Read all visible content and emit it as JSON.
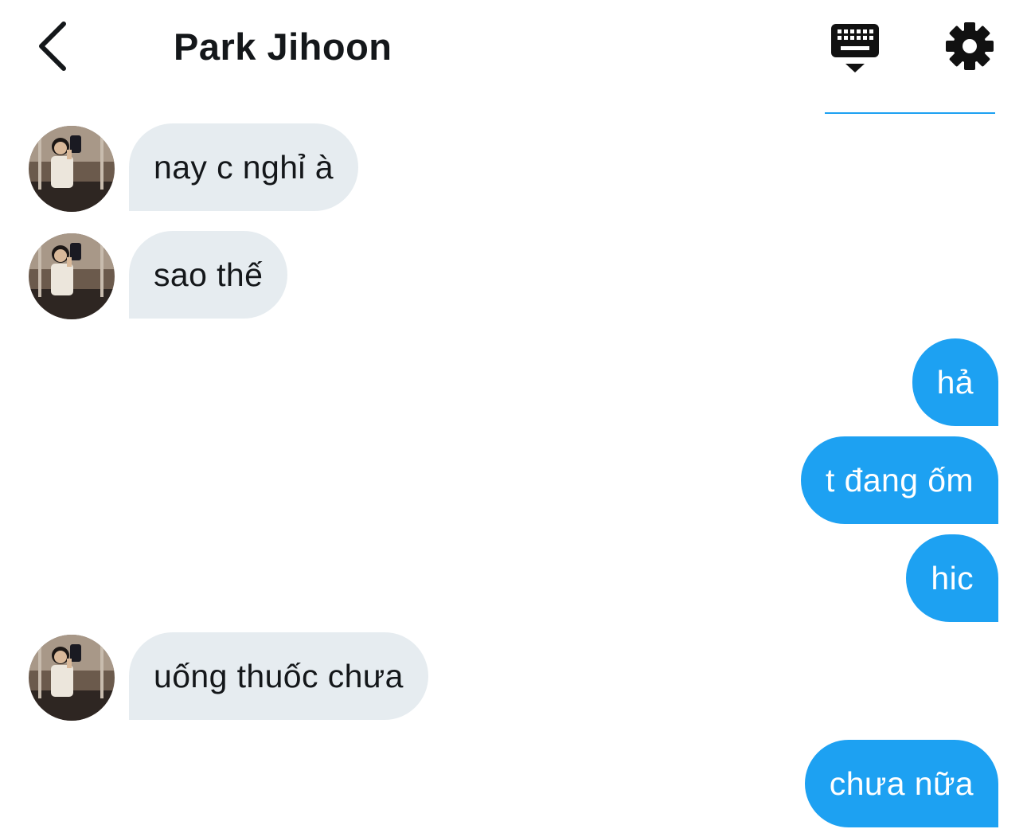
{
  "header": {
    "title": "Park Jihoon",
    "icons": {
      "back": "chevron-left-icon",
      "keyboard": "keyboard-icon",
      "settings": "gear-icon"
    }
  },
  "colors": {
    "accent": "#1da1f2",
    "received_bubble": "#e6ecf0",
    "text": "#14171a"
  },
  "messages": [
    {
      "direction": "in",
      "text": "nay c nghỉ à"
    },
    {
      "direction": "in",
      "text": "sao thế"
    },
    {
      "direction": "out",
      "text": "hả"
    },
    {
      "direction": "out",
      "text": "t đang ốm"
    },
    {
      "direction": "out",
      "text": "hic"
    },
    {
      "direction": "in",
      "text": "uống thuốc chưa"
    },
    {
      "direction": "out",
      "text": "chưa nữa"
    }
  ]
}
